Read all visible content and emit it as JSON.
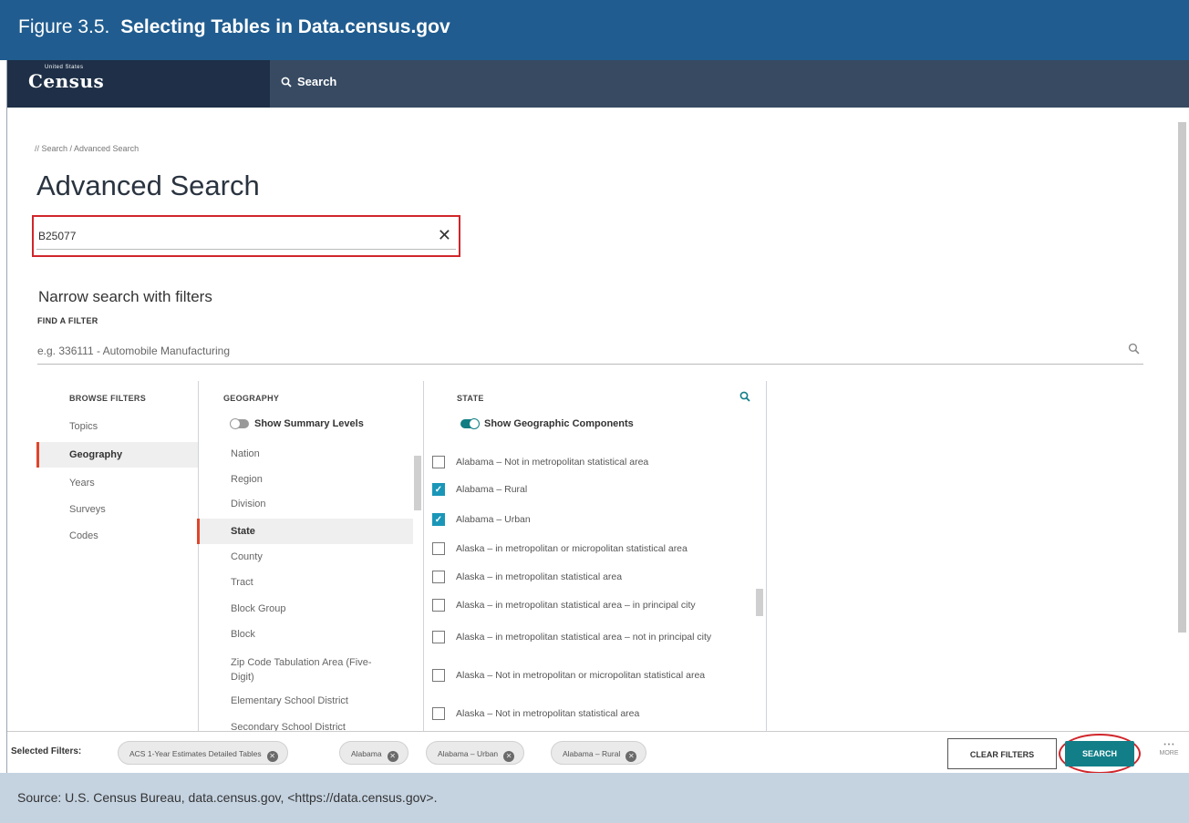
{
  "figure": {
    "number": "Figure 3.5.",
    "title": "Selecting Tables in Data.census.gov",
    "source": "Source: U.S. Census Bureau, data.census.gov, <https://data.census.gov>."
  },
  "nav": {
    "logo_small": "United States",
    "logo": "Census",
    "search_label": "Search"
  },
  "breadcrumb": "// Search / Advanced Search",
  "page_title": "Advanced Search",
  "search": {
    "value": "B25077",
    "clear": "✕"
  },
  "filters": {
    "heading": "Narrow search with filters",
    "find_label": "FIND A FILTER",
    "find_placeholder": "e.g. 336111 - Automobile Manufacturing"
  },
  "browse": {
    "heading": "BROWSE FILTERS",
    "items": [
      "Topics",
      "Geography",
      "Years",
      "Surveys",
      "Codes"
    ]
  },
  "geography": {
    "heading": "GEOGRAPHY",
    "toggle_label": "Show Summary Levels",
    "items": [
      "Nation",
      "Region",
      "Division",
      "State",
      "County",
      "Tract",
      "Block Group",
      "Block",
      "Zip Code Tabulation Area (Five-Digit)",
      "Elementary School District",
      "Secondary School District"
    ]
  },
  "state": {
    "heading": "STATE",
    "toggle_label": "Show Geographic Components",
    "items": [
      {
        "label": "Alabama – Not in metropolitan statistical area",
        "checked": false
      },
      {
        "label": "Alabama – Rural",
        "checked": true
      },
      {
        "label": "Alabama – Urban",
        "checked": true
      },
      {
        "label": "Alaska – in metropolitan or micropolitan statistical area",
        "checked": false
      },
      {
        "label": "Alaska – in metropolitan statistical area",
        "checked": false
      },
      {
        "label": "Alaska – in metropolitan statistical area – in principal city",
        "checked": false
      },
      {
        "label": "Alaska – in metropolitan statistical area – not in principal city",
        "checked": false
      },
      {
        "label": "Alaska – Not in metropolitan or micropolitan statistical area",
        "checked": false
      },
      {
        "label": "Alaska – Not in metropolitan statistical area",
        "checked": false
      }
    ]
  },
  "selected": {
    "label": "Selected Filters:",
    "chips": [
      "ACS 1-Year Estimates Detailed Tables",
      "Alabama",
      "Alabama – Urban",
      "Alabama – Rural"
    ],
    "clear_label": "CLEAR FILTERS",
    "search_label": "SEARCH",
    "more_label": "MORE"
  },
  "colors": {
    "header_bg": "#205c8f",
    "nav_bg": "#374a62",
    "accent": "#127f88",
    "highlight": "#d0262b"
  }
}
